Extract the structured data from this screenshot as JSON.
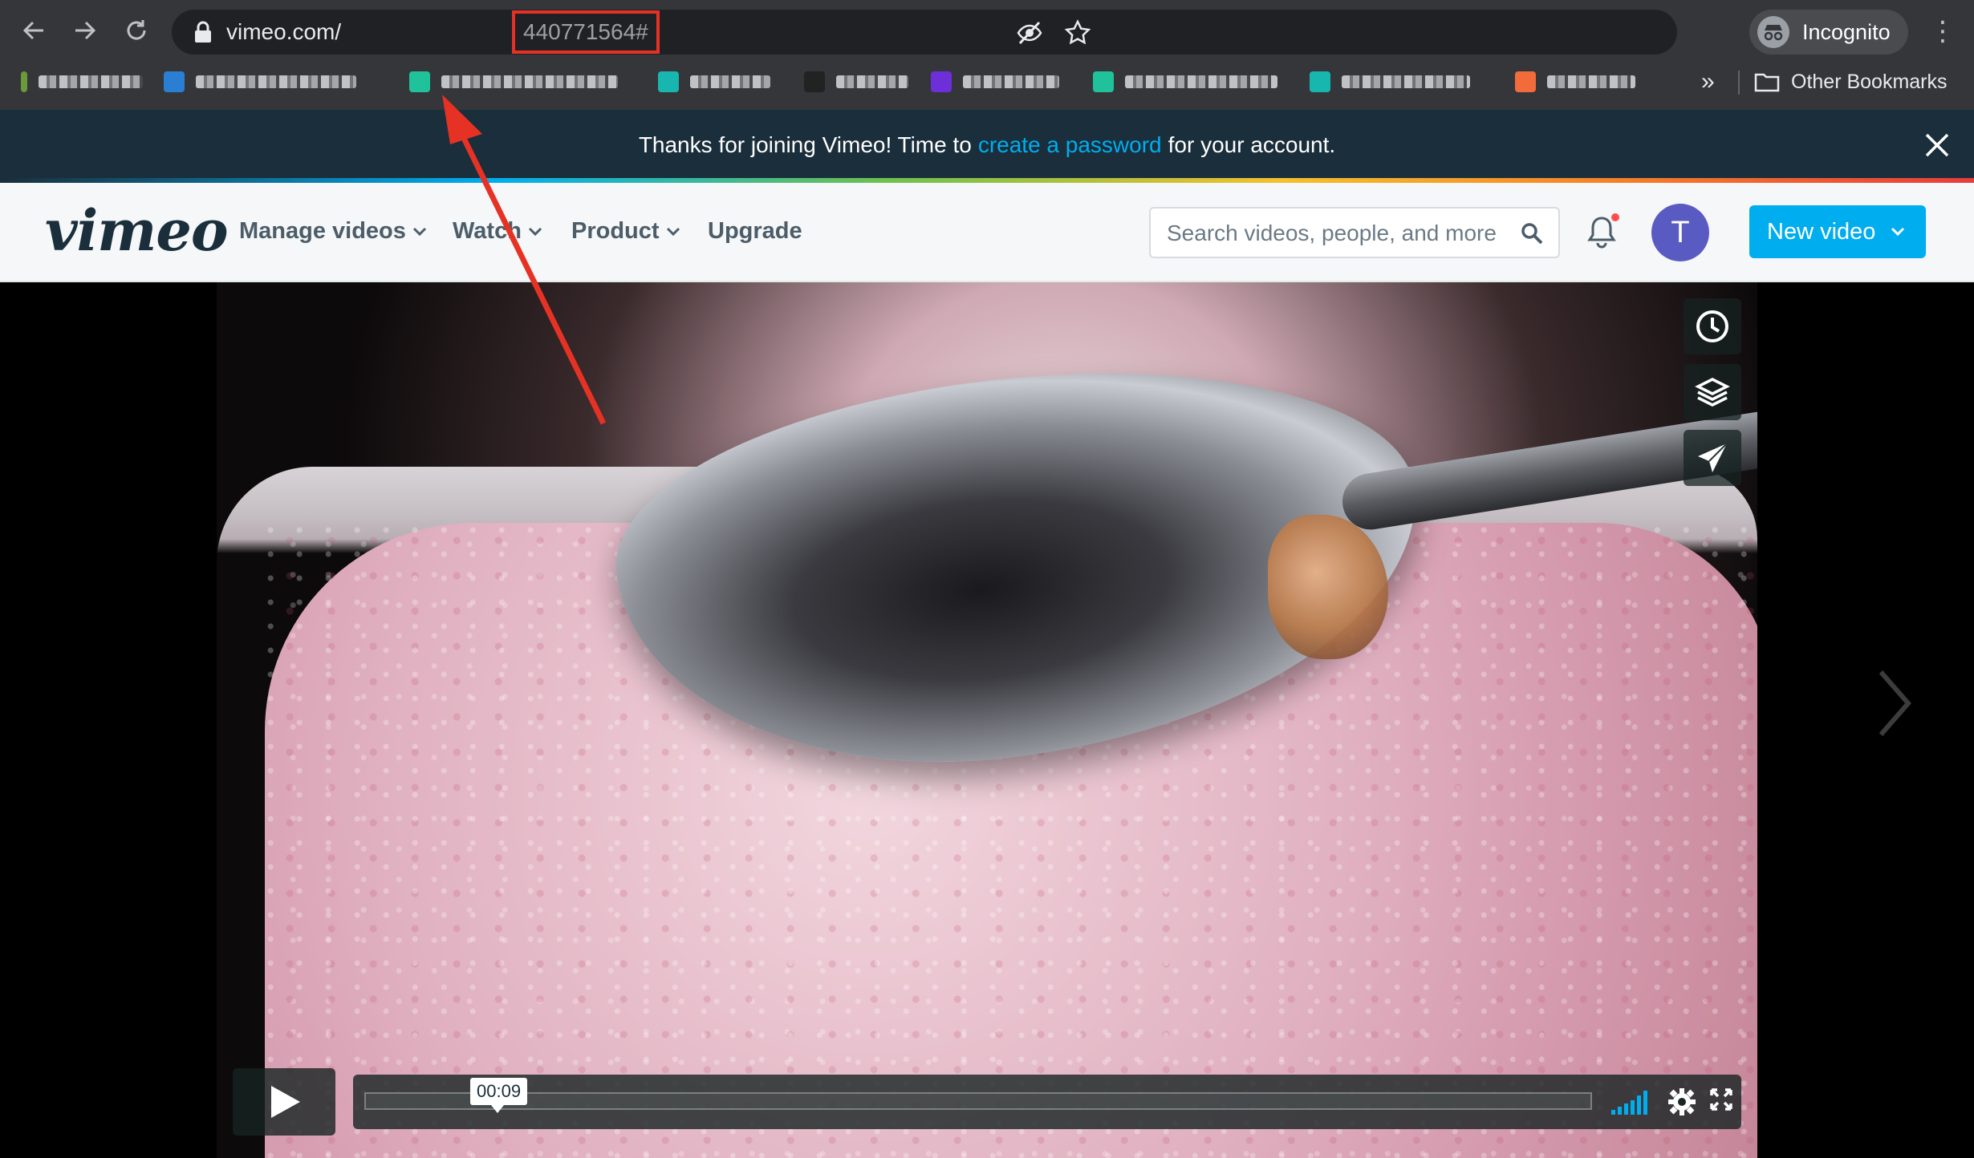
{
  "browser": {
    "url_host": "vimeo.com/",
    "url_path": "440771564#",
    "profile_label": "Incognito",
    "more_bookmarks_label": "»",
    "other_bookmarks_label": "Other Bookmarks",
    "bookmarks": [
      {
        "icon": "bookmark-favicon",
        "color": "#6a9a3a"
      },
      {
        "icon": "bookmark-favicon",
        "color": "#2a7fd4"
      },
      {
        "icon": "bookmark-favicon",
        "color": "#1fc29b"
      },
      {
        "icon": "bookmark-favicon",
        "color": "#17b7b0"
      },
      {
        "icon": "bookmark-favicon",
        "color": "#222222"
      },
      {
        "icon": "bookmark-favicon",
        "color": "#6d2fd8"
      },
      {
        "icon": "bookmark-favicon",
        "color": "#1fc29b"
      },
      {
        "icon": "bookmark-favicon",
        "color": "#17b7b0"
      },
      {
        "icon": "bookmark-favicon",
        "color": "#f26b3a"
      }
    ]
  },
  "banner": {
    "text_before": "Thanks for joining Vimeo! Time to",
    "link_text": "create a password",
    "text_after": "for your account."
  },
  "header": {
    "logo": "vimeo",
    "nav": [
      "Manage videos",
      "Watch",
      "Product",
      "Upgrade"
    ],
    "search_placeholder": "Search videos, people, and more",
    "avatar_initial": "T",
    "new_video_label": "New video"
  },
  "player": {
    "timecode": "00:09",
    "progress": 0
  },
  "colors": {
    "vimeo_blue": "#00adef",
    "banner_bg": "#1a2e3b",
    "annotation_red": "#e53224",
    "avatar": "#5a5bc2"
  }
}
